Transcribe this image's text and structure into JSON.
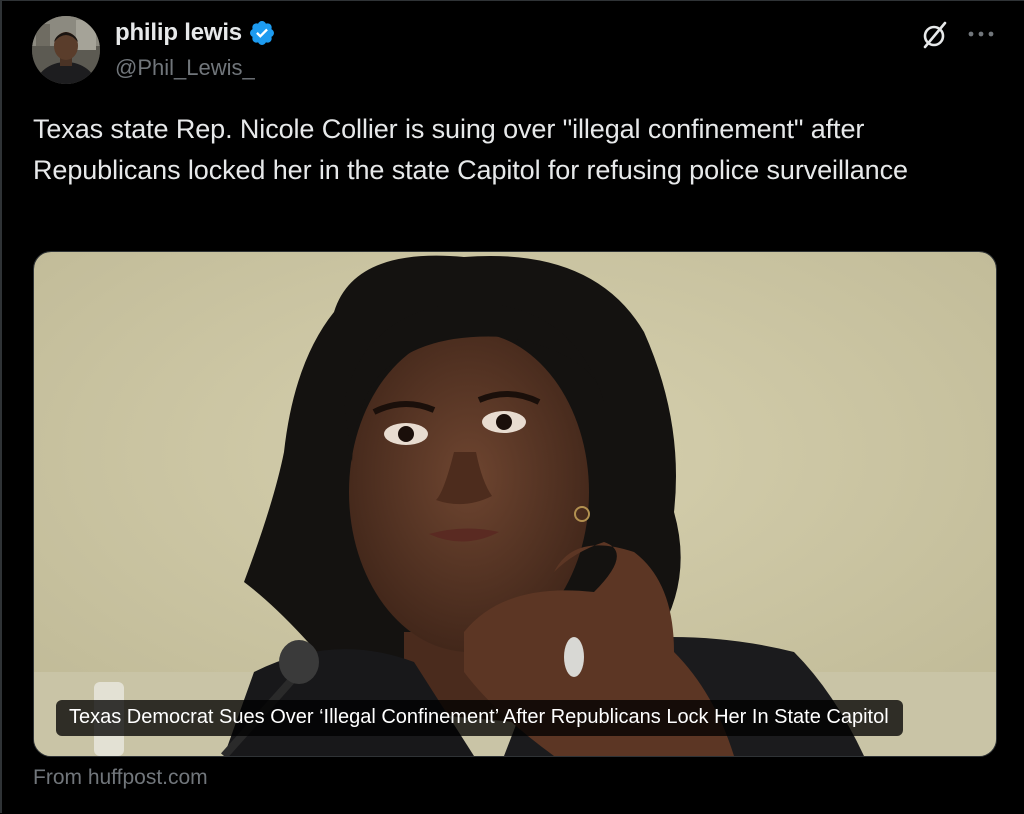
{
  "author": {
    "display_name": "philip lewis",
    "handle": "@Phil_Lewis_",
    "verified": true,
    "avatar_icon": "user-avatar"
  },
  "actions": {
    "grok_icon": "grok-icon",
    "more_icon": "more-dots-icon"
  },
  "tweet": {
    "text": "Texas state Rep. Nicole Collier is suing over \"illegal confinement\" after Republicans locked her in the state Capitol for refusing police surveillance"
  },
  "link_card": {
    "headline": "Texas Democrat Sues Over ‘Illegal Confinement’ After Republicans Lock Her In State Capitol",
    "source": "From huffpost.com"
  },
  "colors": {
    "background": "#000000",
    "text_primary": "#e7e9ea",
    "text_secondary": "#71767b",
    "verified_badge": "#1d9bf0",
    "border": "#2f3336"
  }
}
